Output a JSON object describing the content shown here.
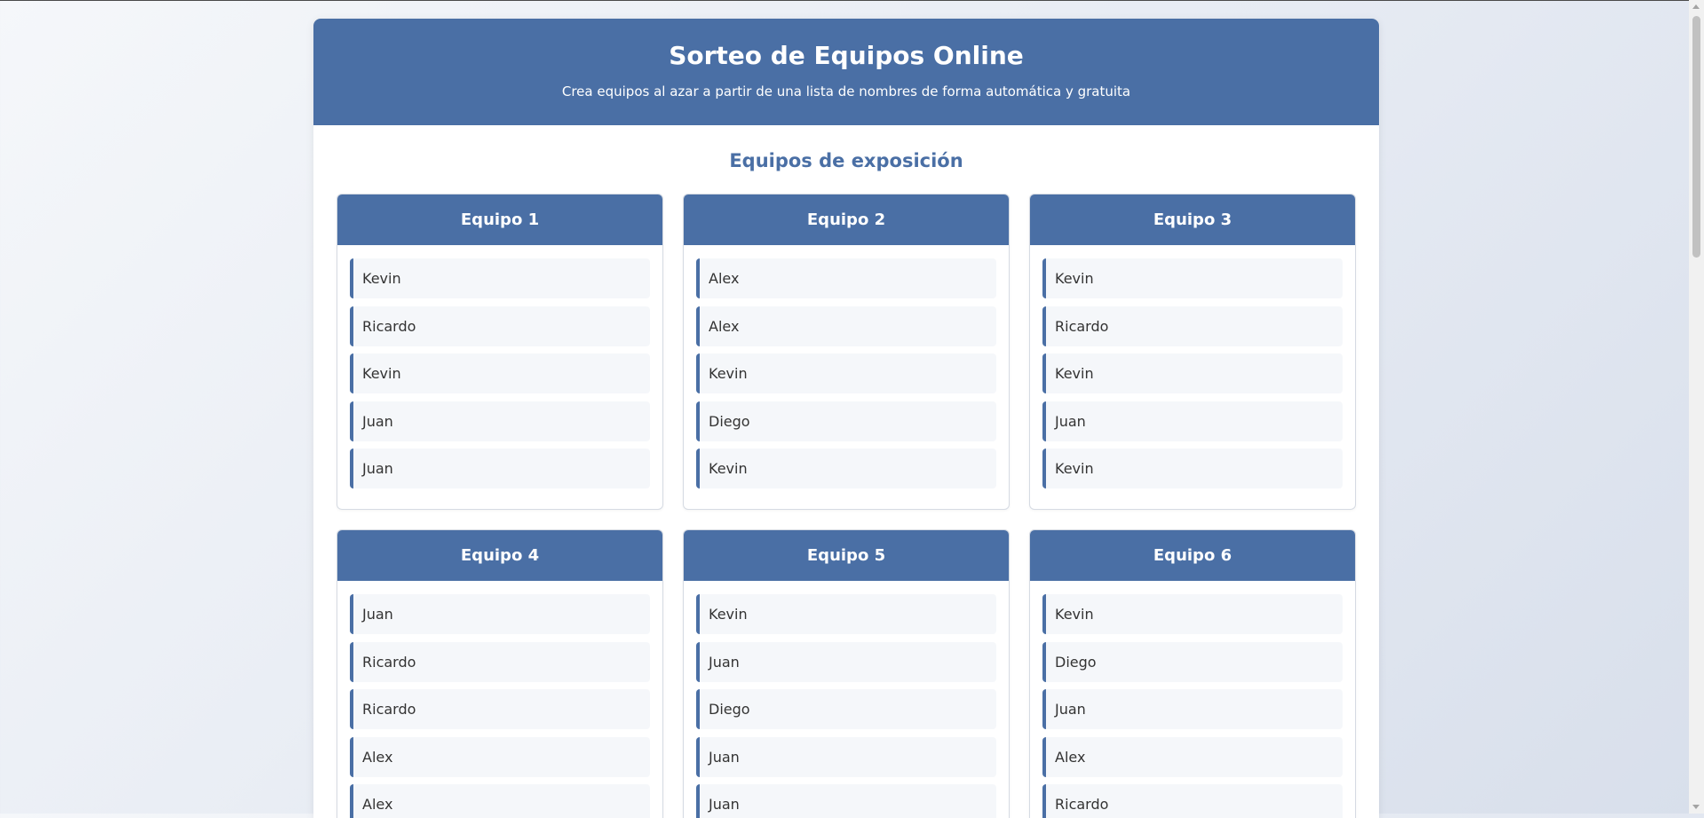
{
  "header": {
    "title": "Sorteo de Equipos Online",
    "subtitle": "Crea equipos al azar a partir de una lista de nombres de forma automática y gratuita"
  },
  "section": {
    "title": "Equipos de exposición"
  },
  "teams": [
    {
      "name": "Equipo 1",
      "members": [
        "Kevin",
        "Ricardo",
        "Kevin",
        "Juan",
        "Juan"
      ]
    },
    {
      "name": "Equipo 2",
      "members": [
        "Alex",
        "Alex",
        "Kevin",
        "Diego",
        "Kevin"
      ]
    },
    {
      "name": "Equipo 3",
      "members": [
        "Kevin",
        "Ricardo",
        "Kevin",
        "Juan",
        "Kevin"
      ]
    },
    {
      "name": "Equipo 4",
      "members": [
        "Juan",
        "Ricardo",
        "Ricardo",
        "Alex",
        "Alex"
      ]
    },
    {
      "name": "Equipo 5",
      "members": [
        "Kevin",
        "Juan",
        "Diego",
        "Juan",
        "Juan"
      ]
    },
    {
      "name": "Equipo 6",
      "members": [
        "Kevin",
        "Diego",
        "Juan",
        "Alex",
        "Ricardo"
      ]
    }
  ],
  "colors": {
    "primary": "#4a6fa5",
    "item_background": "#f5f7fa"
  }
}
